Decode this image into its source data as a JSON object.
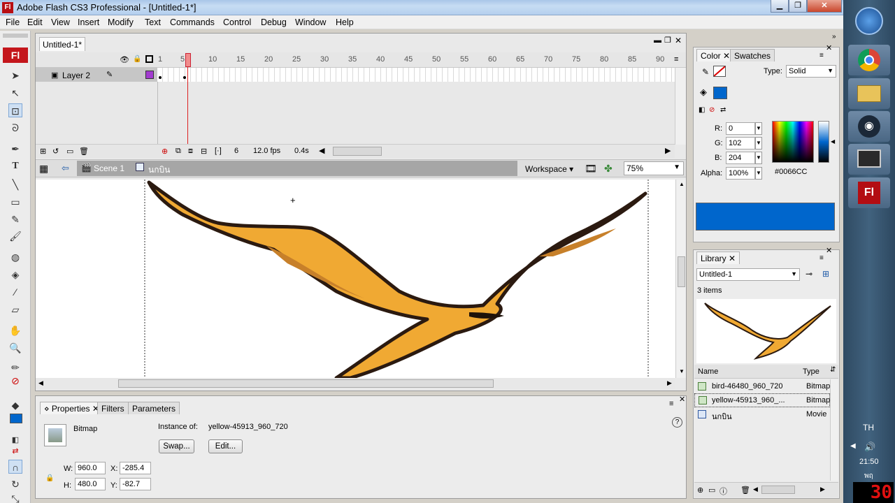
{
  "window": {
    "title": "Adobe Flash CS3 Professional - [Untitled-1*]",
    "app_icon": "Fl"
  },
  "menu": [
    "File",
    "Edit",
    "View",
    "Insert",
    "Modify",
    "Text",
    "Commands",
    "Control",
    "Debug",
    "Window",
    "Help"
  ],
  "document": {
    "tab_label": "Untitled-1*",
    "timeline": {
      "frame_numbers": [
        "1",
        "5",
        "10",
        "15",
        "20",
        "25",
        "30",
        "35",
        "40",
        "45",
        "50",
        "55",
        "60",
        "65",
        "70",
        "75",
        "80",
        "85",
        "90"
      ],
      "current_frame": 6,
      "layer_name": "Layer 2",
      "frame_readout": "6",
      "fps": "12.0 fps",
      "time": "0.4s"
    },
    "edit_bar": {
      "scene": "Scene 1",
      "symbol": "นกบิน",
      "workspace": "Workspace",
      "zoom": "75%"
    }
  },
  "properties": {
    "tabs": [
      "Properties",
      "Filters",
      "Parameters"
    ],
    "type_label": "Bitmap",
    "instance_of_label": "Instance of:",
    "instance_of": "yellow-45913_960_720",
    "swap_label": "Swap...",
    "edit_label": "Edit...",
    "w_label": "W:",
    "w": "960.0",
    "h_label": "H:",
    "h": "480.0",
    "x_label": "X:",
    "x": "-285.4",
    "y_label": "Y:",
    "y": "-82.7"
  },
  "color_panel": {
    "tabs": [
      "Color",
      "Swatches"
    ],
    "type_label": "Type:",
    "type": "Solid",
    "r_label": "R:",
    "r": "0",
    "g_label": "G:",
    "g": "102",
    "b_label": "B:",
    "b": "204",
    "alpha_label": "Alpha:",
    "alpha": "100%",
    "hex": "#0066CC",
    "fill_color": "#0066CC"
  },
  "library": {
    "tab": "Library",
    "document": "Untitled-1",
    "count": "3 items",
    "col_name": "Name",
    "col_type": "Type",
    "items": [
      {
        "name": "bird-46480_960_720",
        "type": "Bitmap",
        "icon": "bitmap-icon"
      },
      {
        "name": "yellow-45913_960_...",
        "type": "Bitmap",
        "icon": "bitmap-icon"
      },
      {
        "name": "นกบิน",
        "type": "Movie",
        "icon": "movieclip-icon"
      }
    ]
  },
  "taskbar": {
    "lang": "TH",
    "time": "21:50",
    "day": "พฤ",
    "overlay_number": "30",
    "icons": [
      "windows-start-icon",
      "chrome-icon",
      "file-explorer-icon",
      "steam-icon",
      "computer-icon",
      "flash-icon"
    ]
  },
  "colors": {
    "accent_blue": "#0066CC",
    "flash_red": "#C4161C",
    "playhead": "#E34040"
  }
}
